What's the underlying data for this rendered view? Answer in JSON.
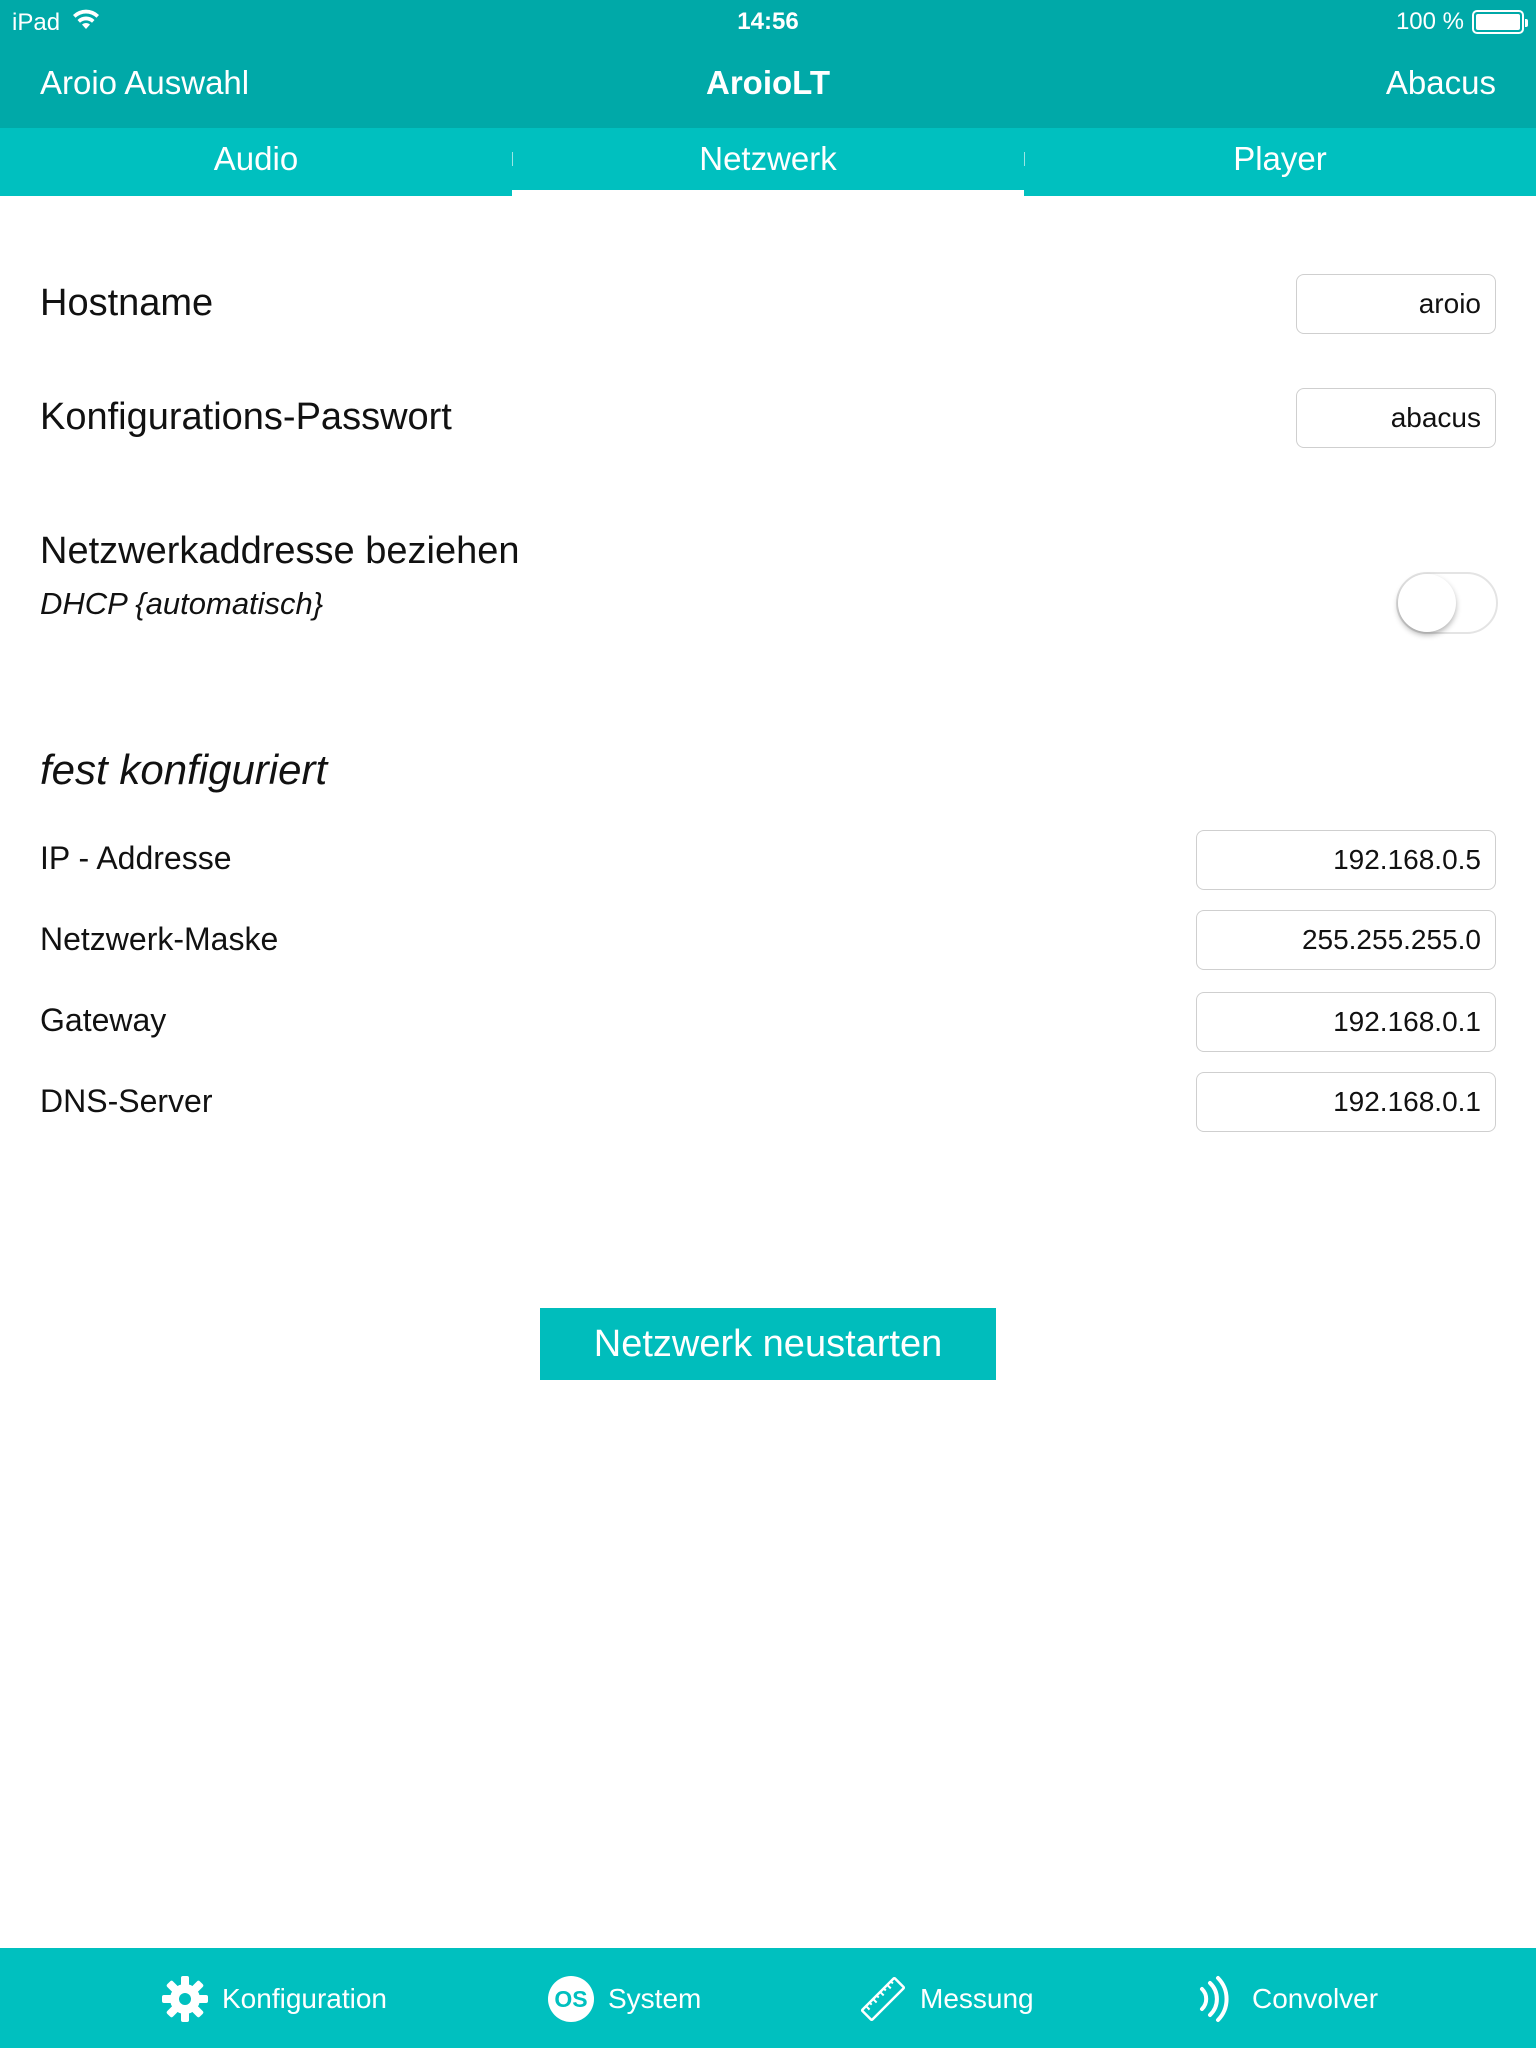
{
  "status_bar": {
    "device": "iPad",
    "time": "14:56",
    "battery": "100 %",
    "battery_level": 1.0,
    "wifi_icon": "wifi-icon",
    "battery_icon": "battery-icon"
  },
  "nav": {
    "back_label": "Aroio Auswahl",
    "title": "AroioLT",
    "right_label": "Abacus"
  },
  "tabs": [
    {
      "label": "Audio",
      "active": false
    },
    {
      "label": "Netzwerk",
      "active": true
    },
    {
      "label": "Player",
      "active": false
    }
  ],
  "settings": {
    "hostname_label": "Hostname",
    "hostname_value": "aroio",
    "password_label": "Konfigurations-Passwort",
    "password_value": "abacus",
    "dhcp_label": "Netzwerkaddresse beziehen",
    "dhcp_sublabel": "DHCP {automatisch}",
    "dhcp_enabled": false
  },
  "static_config": {
    "section_title": "fest konfiguriert",
    "ip_label": "IP - Addresse",
    "ip_value": "192.168.0.5",
    "mask_label": "Netzwerk-Maske",
    "mask_value": "255.255.255.0",
    "gateway_label": "Gateway",
    "gateway_value": "192.168.0.1",
    "dns_label": "DNS-Server",
    "dns_value": "192.168.0.1"
  },
  "actions": {
    "restart_label": "Netzwerk neustarten"
  },
  "bottom_bar": [
    {
      "label": "Konfiguration",
      "icon": "gear-icon"
    },
    {
      "label": "System",
      "icon": "os-icon"
    },
    {
      "label": "Messung",
      "icon": "ruler-icon"
    },
    {
      "label": "Convolver",
      "icon": "sound-waves-icon"
    }
  ],
  "colors": {
    "header": "#00a9a8",
    "tabs": "#00c0bf",
    "button": "#00bdbc"
  }
}
